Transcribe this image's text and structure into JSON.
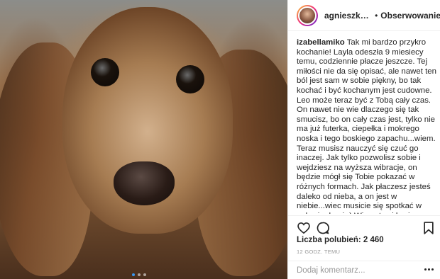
{
  "post": {
    "carousel_count": 3,
    "carousel_active_index": 0
  },
  "header": {
    "username": "agnieszkawl...",
    "separator": "•",
    "follow_label": "Obserwowanie"
  },
  "caption": {
    "author": "izabellamiko",
    "text": "Tak mi bardzo przykro kochanie! Layla odeszła 9 miesiecy temu, codziennie płacze jeszcze. Tej miłości nie da się opisać, ale nawet ten ból jest sam w sobie piękny, bo tak kochać i być kochanym jest cudowne. Leo może teraz być z Tobą cały czas. On nawet nie wie dlaczego się tak smucisz, bo on cały czas jest, tylko nie ma już futerka, ciepełka i mokrego noska i tego boskiego zapachu...wiem. Teraz musisz nauczyć się czuć go inaczej. Jak tylko pozwolisz sobie i wejdziesz na wyższa wibracje, on będzie mógł się Tobie pokazać w różnych formach. Jak płaczesz jesteś daleko od nieba, a on jest w niebie...wiec musicie się spotkać w połowie drogi:-) Wiec otrzyj łzy i pozwol sobie uśmiechnąć się. Nikt z osób które w moim życiu odeszły nie"
  },
  "actions": {
    "like_icon": "heart-outline-icon",
    "comment_icon": "comment-bubble-icon",
    "save_icon": "bookmark-icon"
  },
  "likes": {
    "label": "Liczba polubień: 2 460"
  },
  "timestamp": "12 GODZ. TEMU",
  "comment": {
    "placeholder": "Dodaj komentarz..."
  },
  "colors": {
    "text": "#262626",
    "muted": "#999999",
    "divider": "#efefef",
    "carousel_active": "#3897f0"
  }
}
